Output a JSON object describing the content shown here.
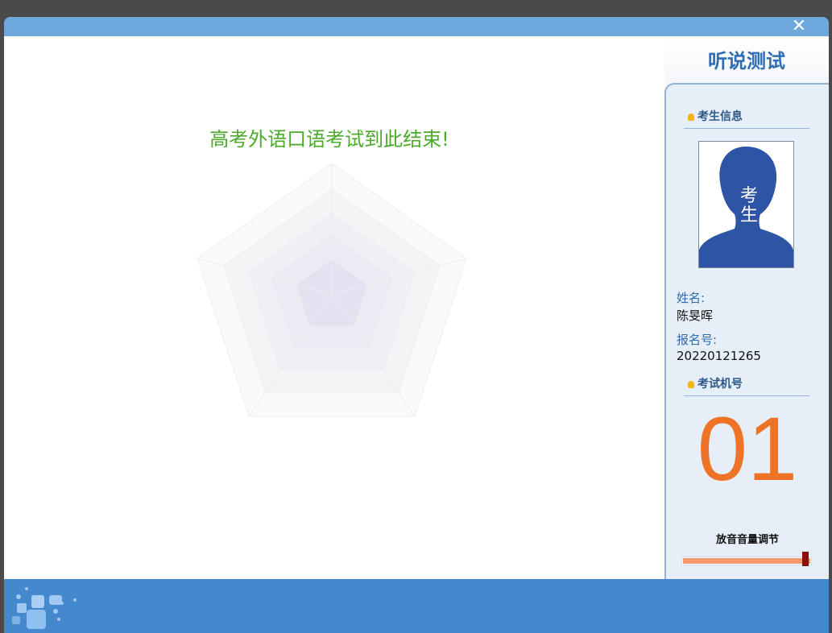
{
  "window": {
    "close_icon": "close-icon"
  },
  "main": {
    "end_message": "高考外语口语考试到此结束!"
  },
  "sidebar": {
    "title": "听说测试",
    "candidate_section": "考生信息",
    "photo_text_top": "考",
    "photo_text_bottom": "生",
    "name_label": "姓名:",
    "name_value": "陈旻晖",
    "reg_label": "报名号:",
    "reg_value": "20220121265",
    "machine_section": "考试机号",
    "machine_no": "01",
    "volume_label": "放音音量调节",
    "volume_level": 0.97
  },
  "colors": {
    "accent": "#4588cd",
    "titlebar": "#6fa8dc",
    "message": "#4caa2a",
    "machine_no": "#ef7326",
    "title": "#2f6db3"
  }
}
